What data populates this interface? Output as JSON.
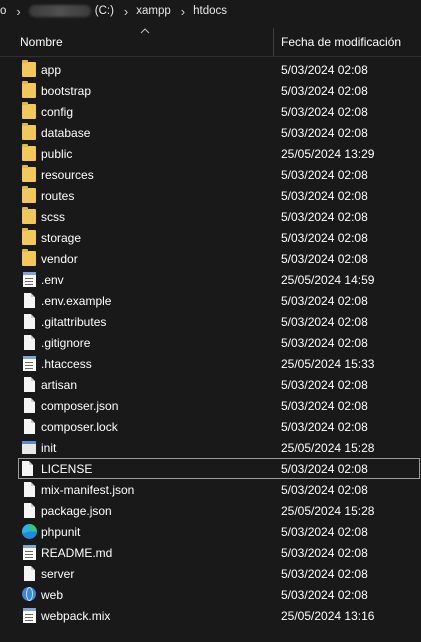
{
  "address_bar": {
    "prefix": "o",
    "drive": "(C:)",
    "path": [
      "xampp",
      "htdocs"
    ]
  },
  "columns": {
    "name": "Nombre",
    "date": "Fecha de modificación"
  },
  "files": [
    {
      "name": "app",
      "date": "5/03/2024 02:08",
      "icon": "folder-icon"
    },
    {
      "name": "bootstrap",
      "date": "5/03/2024 02:08",
      "icon": "folder-icon"
    },
    {
      "name": "config",
      "date": "5/03/2024 02:08",
      "icon": "folder-icon"
    },
    {
      "name": "database",
      "date": "5/03/2024 02:08",
      "icon": "folder-icon"
    },
    {
      "name": "public",
      "date": "25/05/2024 13:29",
      "icon": "folder-icon"
    },
    {
      "name": "resources",
      "date": "5/03/2024 02:08",
      "icon": "folder-icon"
    },
    {
      "name": "routes",
      "date": "5/03/2024 02:08",
      "icon": "folder-icon"
    },
    {
      "name": "scss",
      "date": "5/03/2024 02:08",
      "icon": "folder-icon"
    },
    {
      "name": "storage",
      "date": "5/03/2024 02:08",
      "icon": "folder-icon"
    },
    {
      "name": "vendor",
      "date": "5/03/2024 02:08",
      "icon": "folder-icon"
    },
    {
      "name": ".env",
      "date": "25/05/2024 14:59",
      "icon": "notepad-file-icon"
    },
    {
      "name": ".env.example",
      "date": "5/03/2024 02:08",
      "icon": "file-icon"
    },
    {
      "name": ".gitattributes",
      "date": "5/03/2024 02:08",
      "icon": "file-icon"
    },
    {
      "name": ".gitignore",
      "date": "5/03/2024 02:08",
      "icon": "file-icon"
    },
    {
      "name": ".htaccess",
      "date": "25/05/2024 15:33",
      "icon": "notepad-file-icon"
    },
    {
      "name": "artisan",
      "date": "5/03/2024 02:08",
      "icon": "file-icon"
    },
    {
      "name": "composer.json",
      "date": "5/03/2024 02:08",
      "icon": "file-icon"
    },
    {
      "name": "composer.lock",
      "date": "5/03/2024 02:08",
      "icon": "file-icon"
    },
    {
      "name": "init",
      "date": "25/05/2024 15:28",
      "icon": "command-file-icon"
    },
    {
      "name": "LICENSE",
      "date": "5/03/2024 02:08",
      "icon": "file-icon",
      "selected": true
    },
    {
      "name": "mix-manifest.json",
      "date": "5/03/2024 02:08",
      "icon": "file-icon"
    },
    {
      "name": "package.json",
      "date": "25/05/2024 15:28",
      "icon": "file-icon"
    },
    {
      "name": "phpunit",
      "date": "5/03/2024 02:08",
      "icon": "edge-browser-icon"
    },
    {
      "name": "README.md",
      "date": "5/03/2024 02:08",
      "icon": "notepad-file-icon"
    },
    {
      "name": "server",
      "date": "5/03/2024 02:08",
      "icon": "file-icon"
    },
    {
      "name": "web",
      "date": "5/03/2024 02:08",
      "icon": "globe-icon"
    },
    {
      "name": "webpack.mix",
      "date": "25/05/2024 13:16",
      "icon": "notepad-file-icon"
    }
  ]
}
